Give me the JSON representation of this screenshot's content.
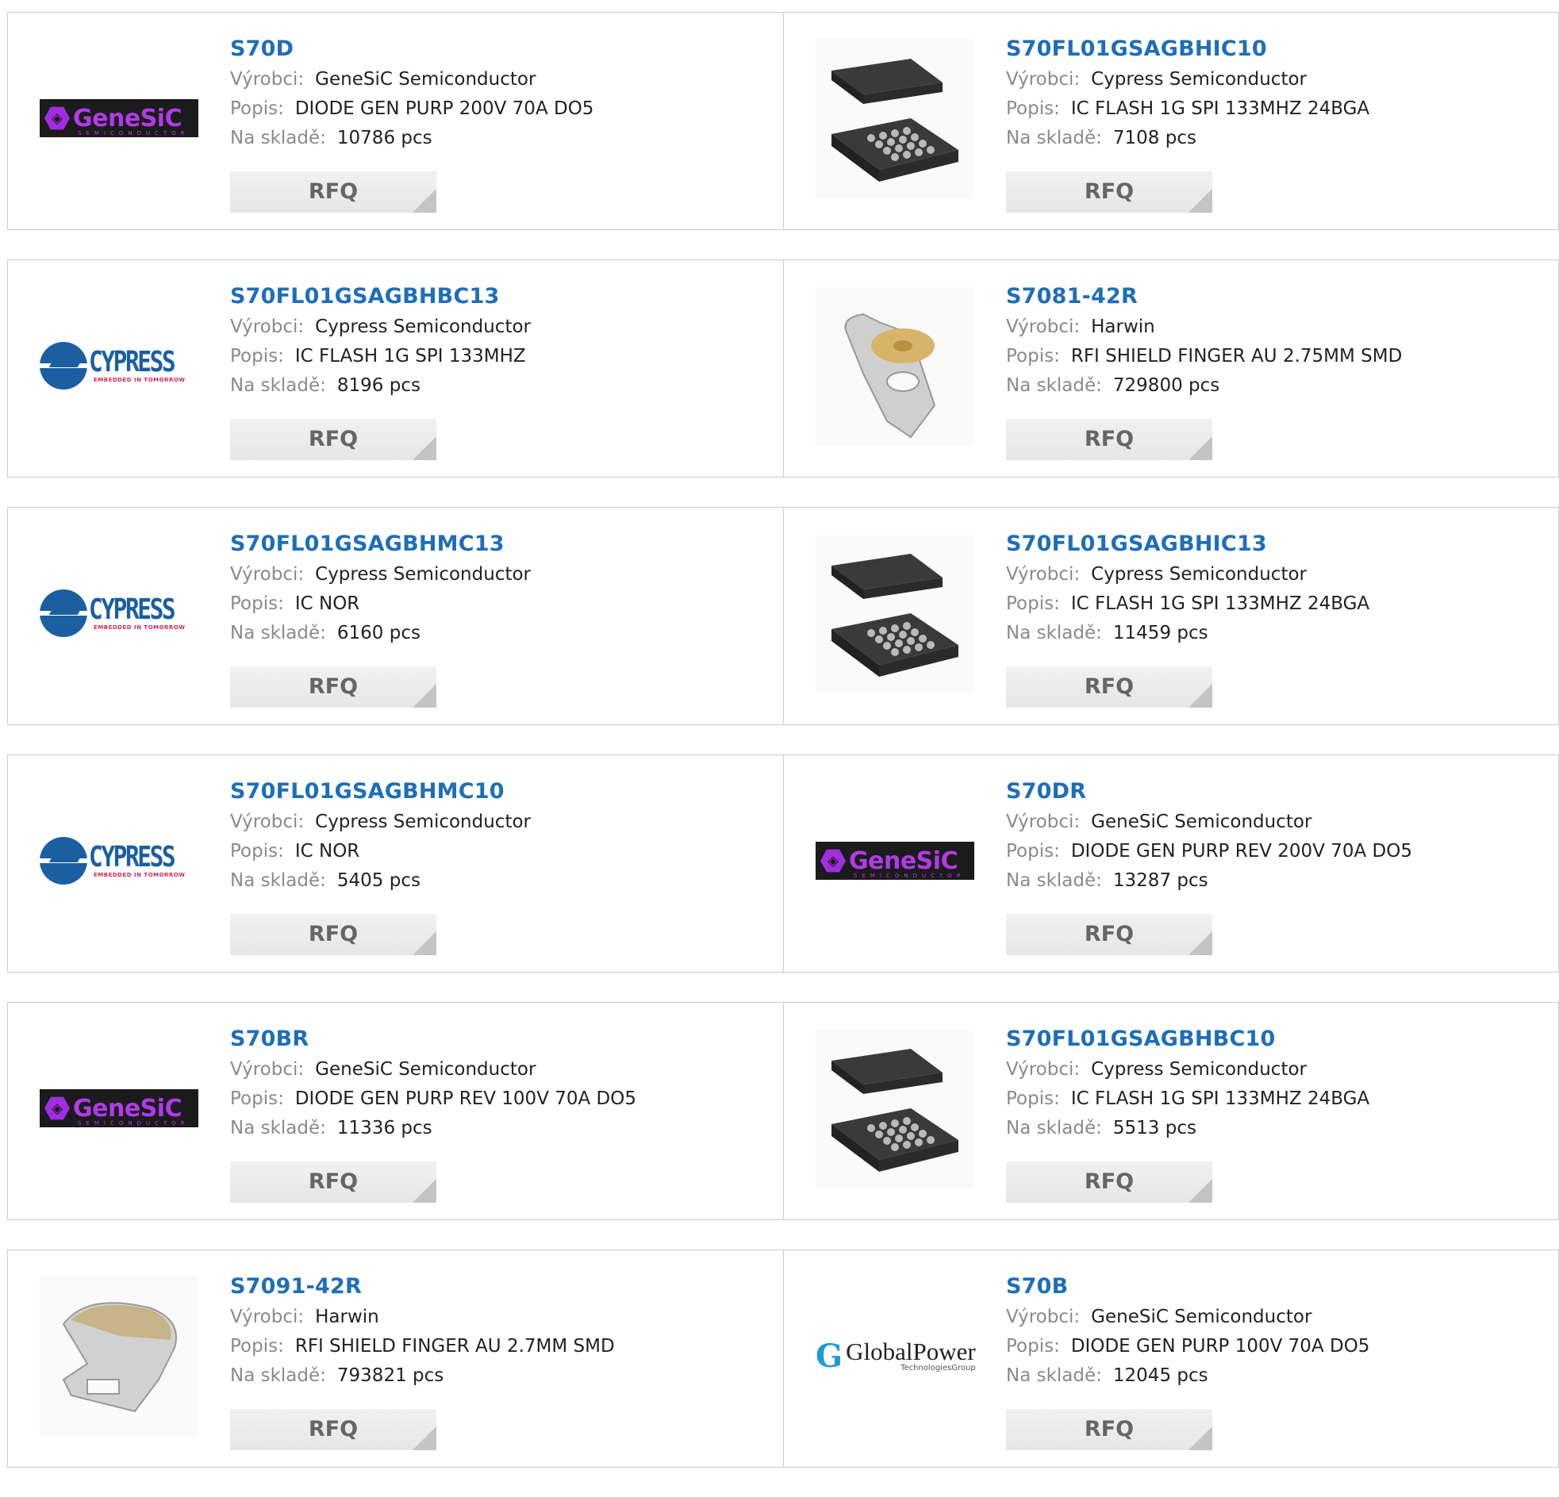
{
  "labels": {
    "manufacturer": "Výrobci:",
    "description": "Popis:",
    "stock": "Na skladě:",
    "rfq": "RFQ"
  },
  "logos": {
    "genesic": {
      "text": "GeneSiC",
      "sub": "SEMICONDUCTOR"
    },
    "cypress": {
      "text": "CYPRESS",
      "sub": "EMBEDDED IN TOMORROW"
    },
    "globalpower": {
      "text": "GlobalPower",
      "sub": "TechnologiesGroup"
    }
  },
  "products": [
    {
      "part": "S70D",
      "manufacturer": "GeneSiC Semiconductor",
      "description": "DIODE GEN PURP 200V 70A DO5",
      "stock": "10786 pcs",
      "image": "genesic-logo"
    },
    {
      "part": "S70FL01GSAGBHIC10",
      "manufacturer": "Cypress Semiconductor",
      "description": "IC FLASH 1G SPI 133MHZ 24BGA",
      "stock": "7108 pcs",
      "image": "bga-chip"
    },
    {
      "part": "S70FL01GSAGBHBC13",
      "manufacturer": "Cypress Semiconductor",
      "description": "IC FLASH 1G SPI 133MHZ",
      "stock": "8196 pcs",
      "image": "cypress-logo"
    },
    {
      "part": "S7081-42R",
      "manufacturer": "Harwin",
      "description": "RFI SHIELD FINGER AU 2.75MM SMD",
      "stock": "729800 pcs",
      "image": "shield-finger-round"
    },
    {
      "part": "S70FL01GSAGBHMC13",
      "manufacturer": "Cypress Semiconductor",
      "description": "IC NOR",
      "stock": "6160 pcs",
      "image": "cypress-logo"
    },
    {
      "part": "S70FL01GSAGBHIC13",
      "manufacturer": "Cypress Semiconductor",
      "description": "IC FLASH 1G SPI 133MHZ 24BGA",
      "stock": "11459 pcs",
      "image": "bga-chip"
    },
    {
      "part": "S70FL01GSAGBHMC10",
      "manufacturer": "Cypress Semiconductor",
      "description": "IC NOR",
      "stock": "5405 pcs",
      "image": "cypress-logo"
    },
    {
      "part": "S70DR",
      "manufacturer": "GeneSiC Semiconductor",
      "description": "DIODE GEN PURP REV 200V 70A DO5",
      "stock": "13287 pcs",
      "image": "genesic-logo"
    },
    {
      "part": "S70BR",
      "manufacturer": "GeneSiC Semiconductor",
      "description": "DIODE GEN PURP REV 100V 70A DO5",
      "stock": "11336 pcs",
      "image": "genesic-logo"
    },
    {
      "part": "S70FL01GSAGBHBC10",
      "manufacturer": "Cypress Semiconductor",
      "description": "IC FLASH 1G SPI 133MHZ 24BGA",
      "stock": "5513 pcs",
      "image": "bga-chip"
    },
    {
      "part": "S7091-42R",
      "manufacturer": "Harwin",
      "description": "RFI SHIELD FINGER AU 2.7MM SMD",
      "stock": "793821 pcs",
      "image": "shield-finger-clip"
    },
    {
      "part": "S70B",
      "manufacturer": "GeneSiC Semiconductor",
      "description": "DIODE GEN PURP 100V 70A DO5",
      "stock": "12045 pcs",
      "image": "globalpower-logo"
    }
  ],
  "colors": {
    "part_link": "#1f6eb8",
    "label": "#8a8a8a",
    "border": "#cccccc",
    "rfq_bg": "#ececec"
  }
}
